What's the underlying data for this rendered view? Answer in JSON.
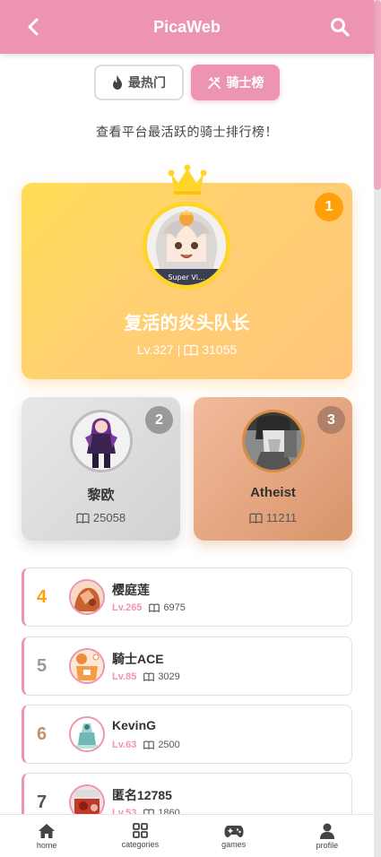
{
  "header": {
    "title": "PicaWeb"
  },
  "tabs": [
    {
      "label": "最热门",
      "icon": "fire-icon",
      "active": false
    },
    {
      "label": "骑士榜",
      "icon": "knight-icon",
      "active": true
    }
  ],
  "subtitle": "查看平台最活跃的骑士排行榜！",
  "first": {
    "rank": "1",
    "name": "复活的炎头队长",
    "level": "Lv.327",
    "separator": "|",
    "comics": "31055",
    "avatar_text": "Super Vi..."
  },
  "second": {
    "rank": "2",
    "name": "黎欧",
    "comics": "25058"
  },
  "third": {
    "rank": "3",
    "name": "Atheist",
    "comics": "11211"
  },
  "list": [
    {
      "rank": "4",
      "name": "樱庭莲",
      "level": "Lv.265",
      "comics": "6975",
      "rank_color": "#ff9f0a"
    },
    {
      "rank": "5",
      "name": "騎士ACE",
      "level": "Lv.85",
      "comics": "3029",
      "rank_color": "#9a9a9a"
    },
    {
      "rank": "6",
      "name": "KevinG",
      "level": "Lv.63",
      "comics": "2500",
      "rank_color": "#c49070"
    },
    {
      "rank": "7",
      "name": "匿名12785",
      "level": "Lv.53",
      "comics": "1860",
      "rank_color": "#555555"
    }
  ],
  "nav": [
    {
      "label": "home",
      "icon": "home-icon"
    },
    {
      "label": "categories",
      "icon": "grid-icon"
    },
    {
      "label": "games",
      "icon": "gamepad-icon"
    },
    {
      "label": "profile",
      "icon": "user-icon"
    }
  ],
  "colors": {
    "accent": "#ee94b3",
    "gold": "#ffd52a",
    "orange": "#ff9f0a"
  }
}
